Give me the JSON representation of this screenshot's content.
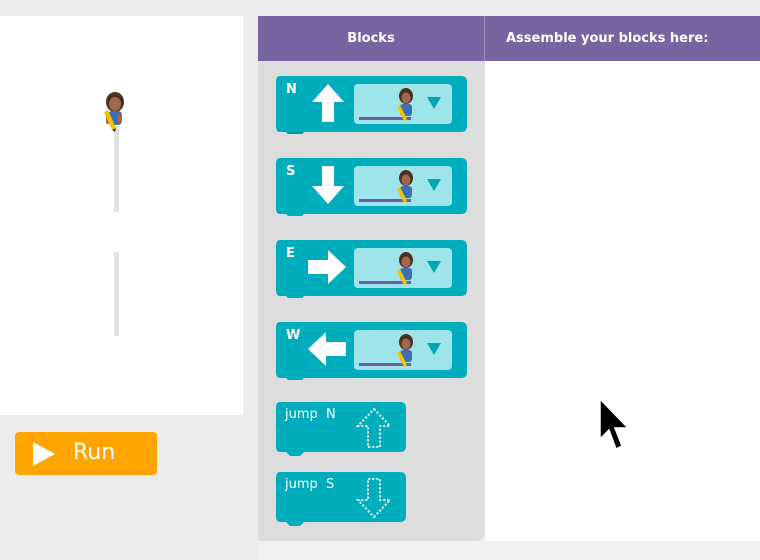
{
  "header": {
    "blocks_label": "Blocks",
    "workspace_label": "Assemble your blocks here:"
  },
  "run_button": {
    "label": "Run"
  },
  "toolbox": {
    "draw_blocks": [
      {
        "direction": "N",
        "label": "N",
        "arrow_icon": "arrow-up-icon"
      },
      {
        "direction": "S",
        "label": "S",
        "arrow_icon": "arrow-down-icon"
      },
      {
        "direction": "E",
        "label": "E",
        "arrow_icon": "arrow-right-icon"
      },
      {
        "direction": "W",
        "label": "W",
        "arrow_icon": "arrow-left-icon"
      }
    ],
    "jump_blocks": [
      {
        "direction": "N",
        "label": "jump  N",
        "arrow_icon": "dotted-arrow-up-icon"
      },
      {
        "direction": "S",
        "label": "jump  S",
        "arrow_icon": "dotted-arrow-down-icon"
      }
    ]
  },
  "colors": {
    "block": "#00adbc",
    "block_dark": "#0096a3",
    "field": "#9ee5ea",
    "header": "#7665a0",
    "run": "#ffa400",
    "line": "#7259a3"
  }
}
